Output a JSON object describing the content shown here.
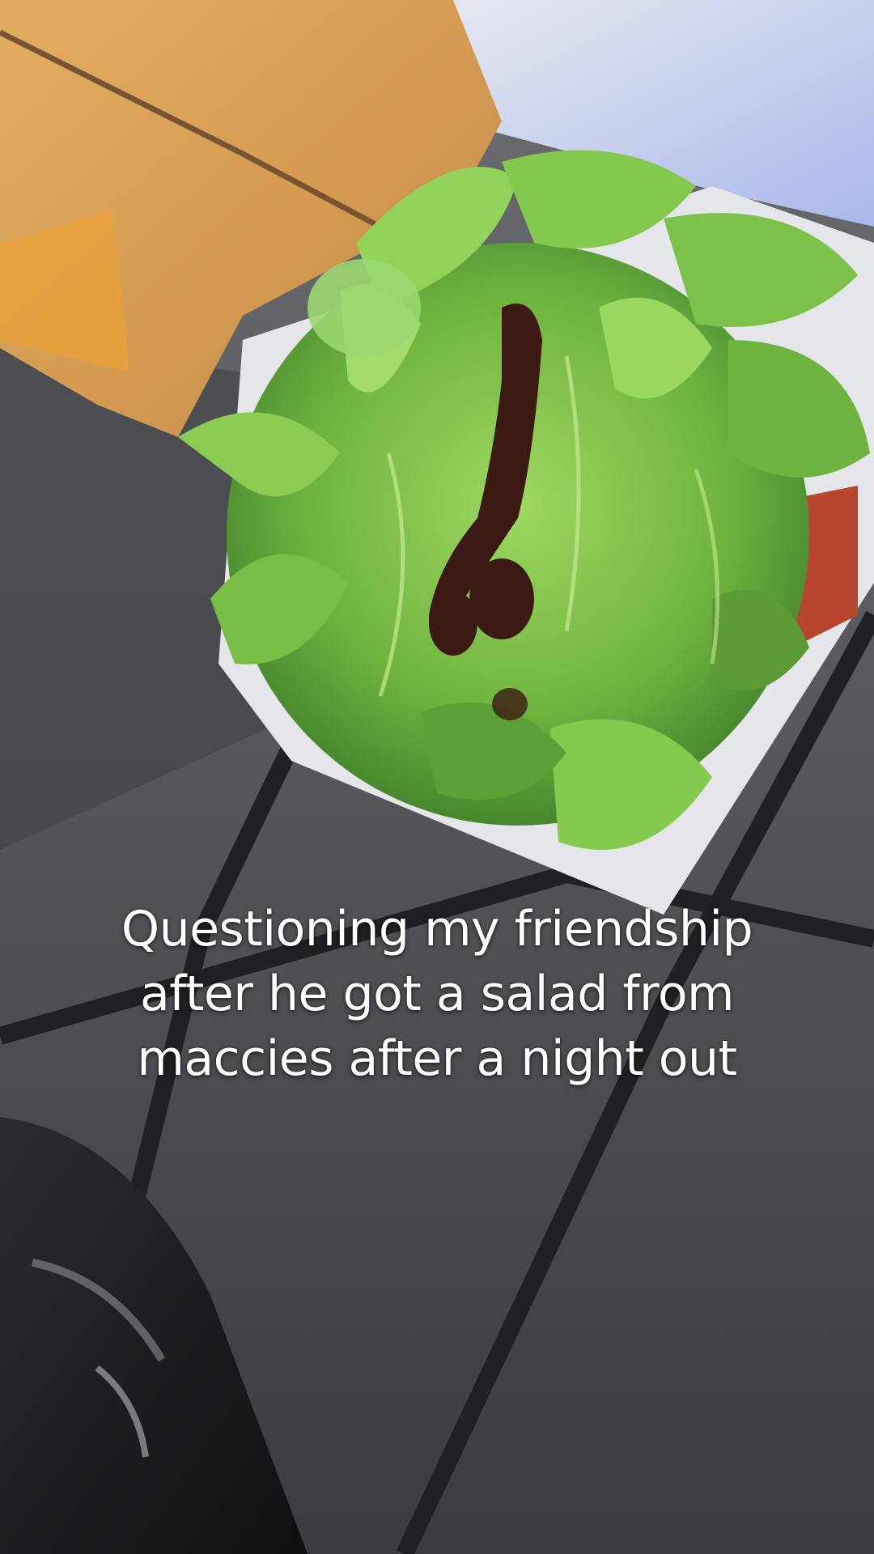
{
  "caption": {
    "lines": [
      "Questioning my friendship",
      "after he got a salad from",
      "maccies after a night out"
    ]
  },
  "colors": {
    "bag": "#d9a55c",
    "lettuce": "#7fc24a",
    "floor": "#55575b",
    "grout": "#1e1f22",
    "sky": "#c9d4ee",
    "sauce": "#3a1a12"
  }
}
